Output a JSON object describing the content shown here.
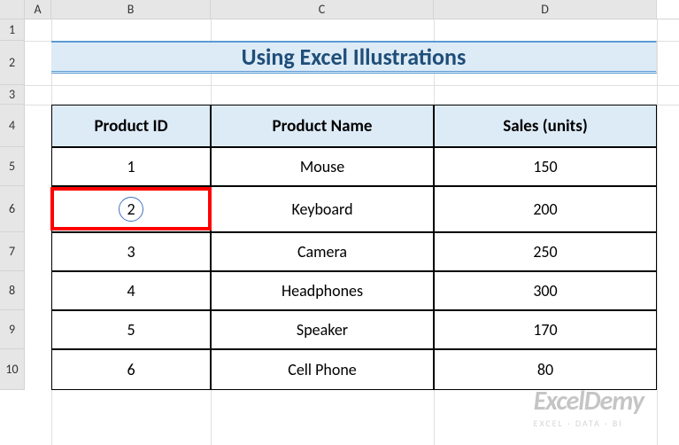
{
  "columns": [
    "A",
    "B",
    "C",
    "D"
  ],
  "rows": [
    "1",
    "2",
    "3",
    "4",
    "5",
    "6",
    "7",
    "8",
    "9",
    "10"
  ],
  "title": "Using Excel Illustrations",
  "table": {
    "headers": {
      "col_b": "Product ID",
      "col_c": "Product Name",
      "col_d": "Sales (units)"
    },
    "rows": [
      {
        "id": "1",
        "name": "Mouse",
        "sales": "150"
      },
      {
        "id": "2",
        "name": "Keyboard",
        "sales": "200"
      },
      {
        "id": "3",
        "name": "Camera",
        "sales": "250"
      },
      {
        "id": "4",
        "name": "Headphones",
        "sales": "300"
      },
      {
        "id": "5",
        "name": "Speaker",
        "sales": "170"
      },
      {
        "id": "6",
        "name": "Cell Phone",
        "sales": "80"
      }
    ]
  },
  "watermark": {
    "title": "ExcelDemy",
    "subtitle": "EXCEL · DATA · BI"
  }
}
